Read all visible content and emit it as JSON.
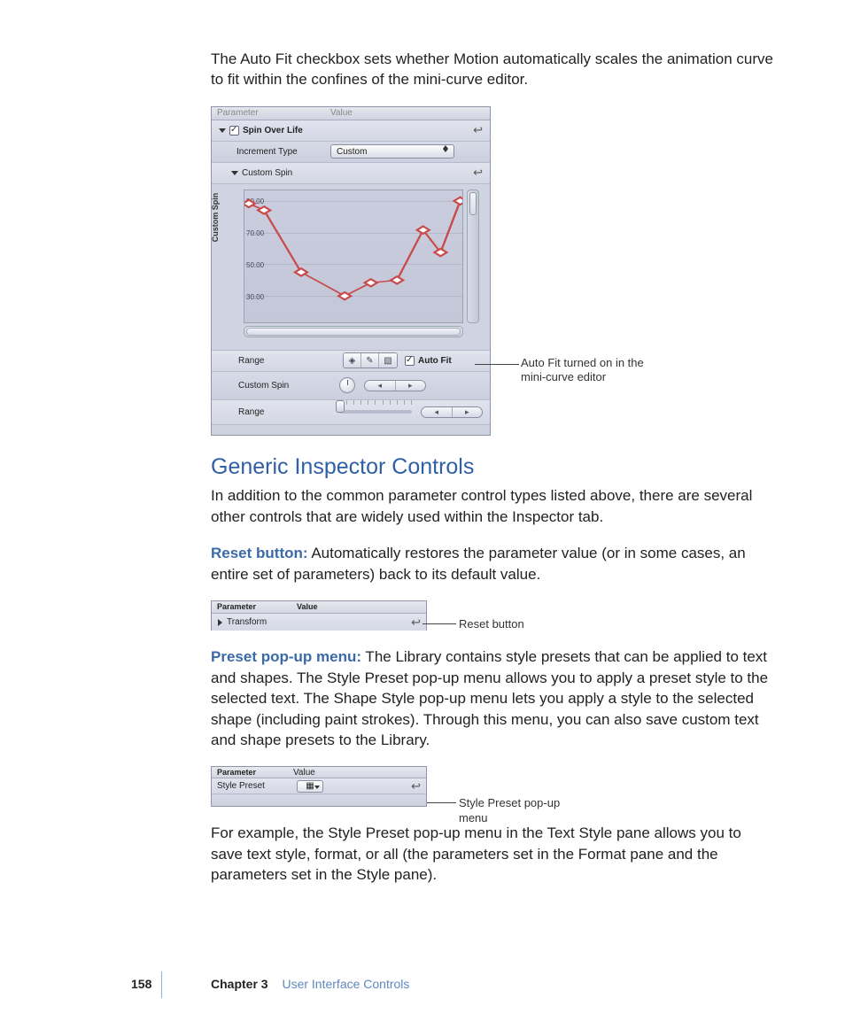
{
  "intro_para": "The Auto Fit checkbox sets whether Motion automatically scales the animation curve to fit within the confines of the mini-curve editor.",
  "shot1": {
    "header_parameter": "Parameter",
    "header_value": "Value",
    "row_spin_over_life": "Spin Over Life",
    "row_increment_type": "Increment Type",
    "popup_custom": "Custom",
    "row_custom_spin_header": "Custom Spin",
    "axis_label": "Custom Spin",
    "tick_90": "90.00",
    "tick_70": "70.00",
    "tick_50": "50.00",
    "tick_30": "30.00",
    "row_range": "Range",
    "auto_fit": "Auto Fit",
    "row_custom_spin2": "Custom Spin",
    "row_range2": "Range"
  },
  "callout1_l1": "Auto Fit turned on in the",
  "callout1_l2": "mini-curve editor",
  "heading": "Generic Inspector Controls",
  "para_after_heading": "In addition to the common parameter control types listed above, there are several other controls that are widely used within the Inspector tab.",
  "term_reset": "Reset button:",
  "reset_text": "  Automatically restores the parameter value (or in some cases, an entire set of parameters) back to its default value.",
  "shot2": {
    "parameter": "Parameter",
    "value": "Value",
    "transform": "Transform"
  },
  "callout2": "Reset button",
  "term_preset": "Preset pop-up menu:",
  "preset_text": "  The Library contains style presets that can be applied to text and shapes. The Style Preset pop-up menu allows you to apply a preset style to the selected text. The Shape Style pop-up menu lets you apply a style to the selected shape (including paint strokes). Through this menu, you can also save custom text and shape presets to the Library.",
  "shot3": {
    "parameter": "Parameter",
    "value": "Value",
    "style_preset": "Style Preset"
  },
  "callout3_l1": "Style Preset pop-up",
  "callout3_l2": "menu",
  "example_para": "For example, the Style Preset pop-up menu in the Text Style pane allows you to save text style, format, or all (the parameters set in the Format pane and the parameters set in the Style pane).",
  "footer": {
    "page": "158",
    "chapter": "Chapter 3",
    "title": "User Interface Controls"
  },
  "chart_data": {
    "type": "line",
    "title": "Custom Spin",
    "ylabel": "Custom Spin",
    "ylim": [
      20,
      95
    ],
    "series": [
      {
        "name": "Custom Spin",
        "x": [
          0,
          0.08,
          0.25,
          0.45,
          0.58,
          0.7,
          0.82,
          0.9,
          1.0
        ],
        "y": [
          90,
          86,
          45,
          30,
          38,
          40,
          72,
          58,
          92
        ]
      }
    ]
  }
}
